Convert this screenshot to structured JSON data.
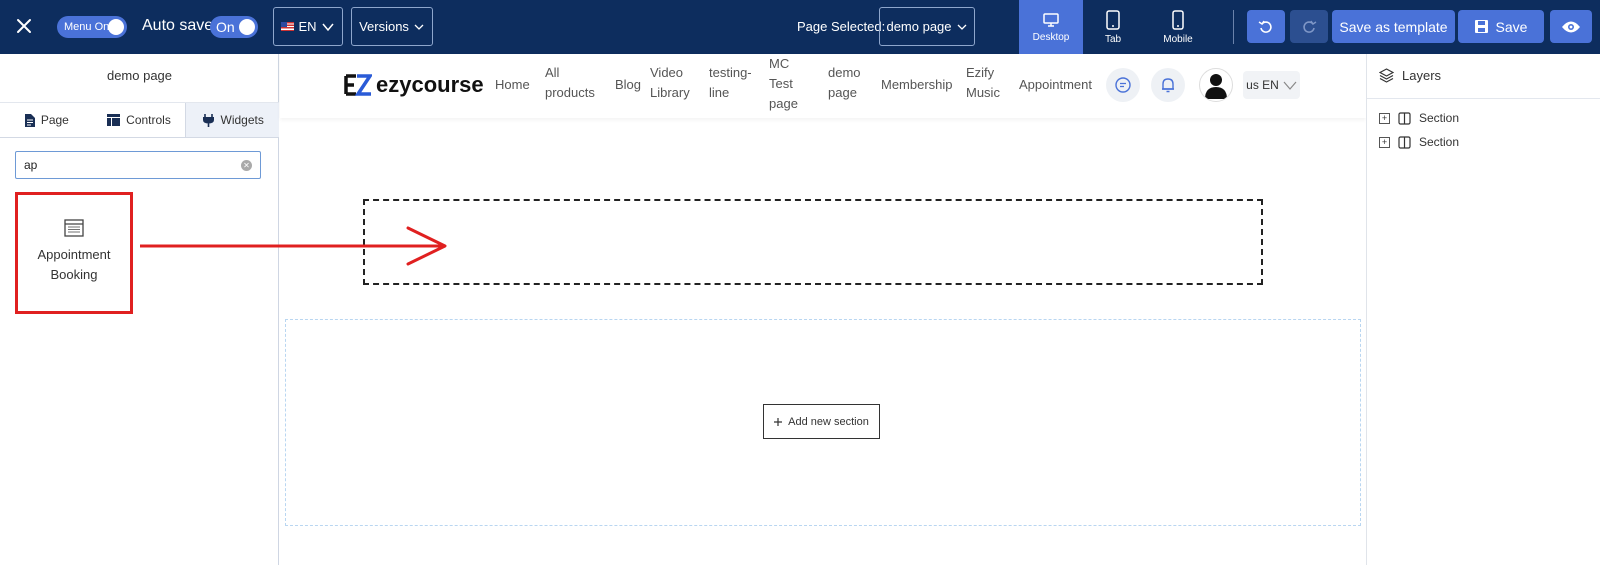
{
  "topbar": {
    "menu_toggle_label": "Menu On",
    "autosave_label": "Auto save:",
    "autosave_toggle_label": "On",
    "lang_label": "EN",
    "versions_label": "Versions",
    "page_selected_label": "Page Selected:",
    "page_selected_value": "demo page",
    "devices": [
      {
        "label": "Desktop",
        "icon": "desktop-icon",
        "active": true
      },
      {
        "label": "Tab",
        "icon": "tablet-icon",
        "active": false
      },
      {
        "label": "Mobile",
        "icon": "mobile-icon",
        "active": false
      }
    ],
    "save_template_label": "Save as template",
    "save_label": "Save",
    "colors": {
      "bar": "#0d2d5e",
      "accent": "#4a72d8"
    }
  },
  "left_panel": {
    "title": "demo page",
    "tabs": [
      {
        "label": "Page",
        "icon": "page-icon",
        "active": false
      },
      {
        "label": "Controls",
        "icon": "controls-icon",
        "active": false
      },
      {
        "label": "Widgets",
        "icon": "plug-icon",
        "active": true
      }
    ],
    "search": {
      "value": "ap"
    },
    "widgets": [
      {
        "label": "Appointment Booking",
        "icon": "calendar-icon"
      }
    ]
  },
  "canvas": {
    "logo_text": "ezycourse",
    "nav": [
      {
        "label": "Home"
      },
      {
        "label": "All products"
      },
      {
        "label": "Blog"
      },
      {
        "label": "Video Library"
      },
      {
        "label": "testing-line"
      },
      {
        "label": "MC Test page"
      },
      {
        "label": "demo page"
      },
      {
        "label": "Membership"
      },
      {
        "label": "Ezify Music"
      },
      {
        "label": "Appointment"
      }
    ],
    "lang_chip": "us EN",
    "add_section_label": "Add new section",
    "highlight_color": "#e02020"
  },
  "right_panel": {
    "title": "Layers",
    "layers": [
      {
        "label": "Section"
      },
      {
        "label": "Section"
      }
    ]
  }
}
